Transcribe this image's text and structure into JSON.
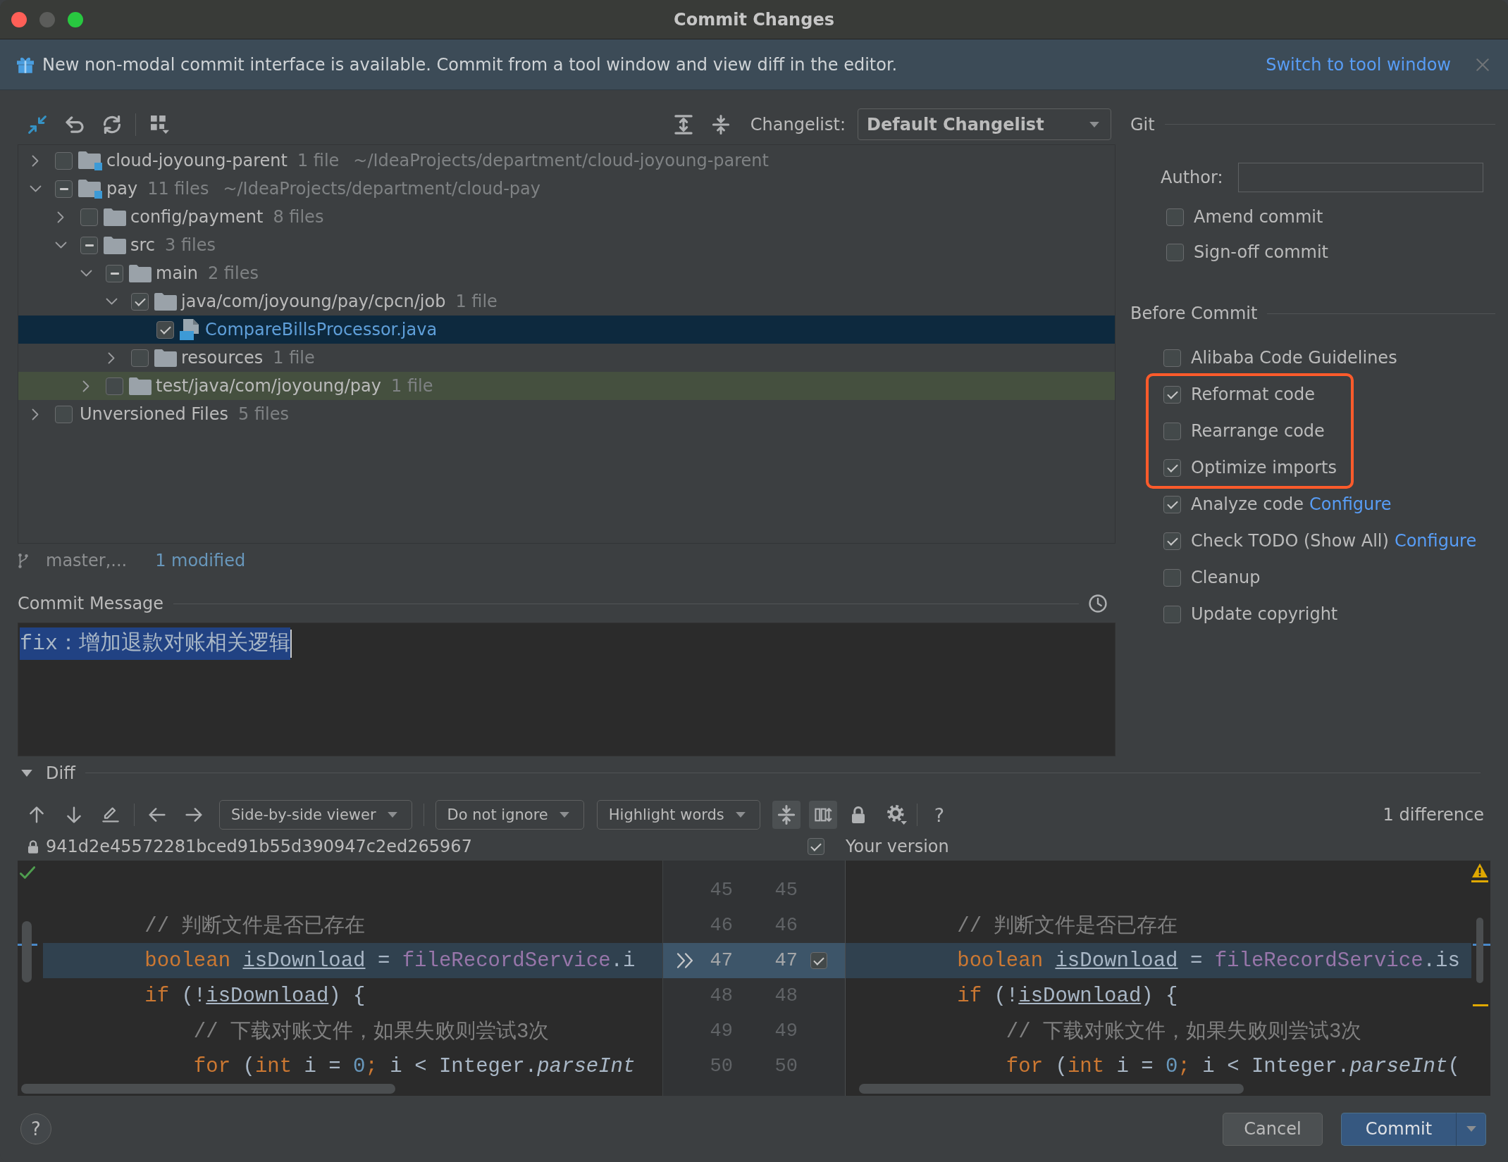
{
  "window": {
    "title": "Commit Changes",
    "controls": [
      {
        "kind": "close",
        "disabled": false
      },
      {
        "kind": "minimize",
        "disabled": true
      },
      {
        "kind": "zoom",
        "disabled": false
      }
    ]
  },
  "banner": {
    "text": "New non-modal commit interface is available. Commit from a tool window and view diff in the editor.",
    "link": "Switch to tool window"
  },
  "changes": {
    "changelist_label": "Changelist:",
    "changelist": "Default Changelist",
    "tree": [
      {
        "name": "cloud-joyoung-parent",
        "kind": "module",
        "count": "1 file",
        "path": "~/IdeaProjects/department/cloud-joyoung-parent",
        "checked": false,
        "partial": false,
        "expanded": false,
        "selected": false,
        "test_source": false
      },
      {
        "name": "pay",
        "kind": "module",
        "count": "11 files",
        "path": "~/IdeaProjects/department/cloud-pay",
        "checked": true,
        "partial": true,
        "expanded": true,
        "selected": false,
        "test_source": false,
        "children": [
          {
            "name": "config/payment",
            "kind": "folder",
            "count": "8 files",
            "checked": false,
            "partial": false,
            "expanded": false,
            "selected": false,
            "test_source": false
          },
          {
            "name": "src",
            "kind": "folder",
            "count": "3 files",
            "checked": true,
            "partial": true,
            "expanded": true,
            "selected": false,
            "test_source": false,
            "children": [
              {
                "name": "main",
                "kind": "folder",
                "count": "2 files",
                "checked": true,
                "partial": true,
                "expanded": true,
                "selected": false,
                "test_source": false,
                "children": [
                  {
                    "name": "java/com/joyoung/pay/cpcn/job",
                    "kind": "folder",
                    "count": "1 file",
                    "checked": true,
                    "partial": false,
                    "expanded": true,
                    "selected": false,
                    "test_source": false,
                    "children": [
                      {
                        "name": "CompareBillsProcessor.java",
                        "kind": "java-file",
                        "modified": true,
                        "checked": true,
                        "partial": false,
                        "selected": true,
                        "test_source": false
                      }
                    ]
                  },
                  {
                    "name": "resources",
                    "kind": "folder",
                    "count": "1 file",
                    "checked": false,
                    "partial": false,
                    "expanded": false,
                    "selected": false,
                    "test_source": false
                  }
                ]
              },
              {
                "name": "test/java/com/joyoung/pay",
                "kind": "folder",
                "count": "1 file",
                "checked": false,
                "partial": false,
                "expanded": false,
                "selected": false,
                "test_source": true
              }
            ]
          }
        ]
      },
      {
        "name": "Unversioned Files",
        "kind": "group",
        "count": "5 files",
        "checked": false,
        "partial": false,
        "expanded": false,
        "selected": false,
        "test_source": false
      }
    ],
    "branch": "master,...",
    "summary": "1 modified"
  },
  "commit_message": {
    "label": "Commit Message",
    "text": "fix：增加退款对账相关逻辑",
    "selected": true
  },
  "git": {
    "title": "Git",
    "author_label": "Author:",
    "options": [
      {
        "label": "Amend commit",
        "checked": false
      },
      {
        "label": "Sign-off commit",
        "checked": false
      }
    ]
  },
  "before_commit": {
    "title": "Before Commit",
    "options": [
      {
        "label": "Alibaba Code Guidelines",
        "checked": false,
        "highlighted": false
      },
      {
        "label": "Reformat code",
        "checked": true,
        "highlighted": true
      },
      {
        "label": "Rearrange code",
        "checked": false,
        "highlighted": true
      },
      {
        "label": "Optimize imports",
        "checked": true,
        "highlighted": true
      },
      {
        "label": "Analyze code",
        "checked": true,
        "highlighted": false,
        "link": "Configure"
      },
      {
        "label": "Check TODO (Show All)",
        "checked": true,
        "highlighted": false,
        "link": "Configure"
      },
      {
        "label": "Cleanup",
        "checked": false,
        "highlighted": false
      },
      {
        "label": "Update copyright",
        "checked": false,
        "highlighted": false
      }
    ]
  },
  "diff": {
    "title": "Diff",
    "expanded": true,
    "toolbar": {
      "dropdowns": [
        {
          "label": "Side-by-side viewer"
        },
        {
          "label": "Do not ignore"
        },
        {
          "label": "Highlight words"
        }
      ],
      "toggles": [
        {
          "kind": "collapse-unchanged",
          "on": true
        },
        {
          "kind": "sync-scroll",
          "on": true
        }
      ],
      "help": "?",
      "count": "1 difference"
    },
    "left": {
      "revision": "941d2e45572281bced91b55d390947c2ed265967"
    },
    "right": {
      "title": "Your version",
      "included": true
    },
    "lines": [
      {
        "left_number": "45",
        "right_number": "45",
        "changed": false
      },
      {
        "left_number": "46",
        "right_number": "46",
        "changed": false,
        "left": [
          {
            "kind": "comment",
            "text": "        // 判断文件是否已存在"
          }
        ],
        "right": [
          {
            "kind": "comment",
            "text": "        // 判断文件是否已存在"
          }
        ]
      },
      {
        "left_number": "47",
        "right_number": "47",
        "changed": true,
        "included": true,
        "left": [
          {
            "kind": "keyword",
            "text": "        boolean "
          },
          {
            "kind": "reassigned",
            "text": "isDownload"
          },
          {
            "kind": "plain",
            "text": " = "
          },
          {
            "kind": "field",
            "text": "fileRecordService"
          },
          {
            "kind": "plain",
            "text": ".i"
          }
        ],
        "right": [
          {
            "kind": "keyword",
            "text": "        boolean "
          },
          {
            "kind": "reassigned",
            "text": "isDownload"
          },
          {
            "kind": "plain",
            "text": " = "
          },
          {
            "kind": "field",
            "text": "fileRecordService"
          },
          {
            "kind": "plain",
            "text": ".is"
          }
        ]
      },
      {
        "left_number": "48",
        "right_number": "48",
        "changed": false,
        "left": [
          {
            "kind": "keyword",
            "text": "        if"
          },
          {
            "kind": "plain",
            "text": " (!"
          },
          {
            "kind": "reassigned",
            "text": "isDownload"
          },
          {
            "kind": "plain",
            "text": ") {"
          }
        ],
        "right": [
          {
            "kind": "keyword",
            "text": "        if"
          },
          {
            "kind": "plain",
            "text": " (!"
          },
          {
            "kind": "reassigned",
            "text": "isDownload"
          },
          {
            "kind": "plain",
            "text": ") {"
          }
        ]
      },
      {
        "left_number": "49",
        "right_number": "49",
        "changed": false,
        "left": [
          {
            "kind": "comment",
            "text": "            // 下载对账文件，如果失败则尝试3次"
          }
        ],
        "right": [
          {
            "kind": "comment",
            "text": "            // 下载对账文件，如果失败则尝试3次"
          }
        ]
      },
      {
        "left_number": "50",
        "right_number": "50",
        "changed": false,
        "left": [
          {
            "kind": "keyword",
            "text": "            for"
          },
          {
            "kind": "plain",
            "text": " ("
          },
          {
            "kind": "keyword",
            "text": "int"
          },
          {
            "kind": "plain",
            "text": " i = "
          },
          {
            "kind": "number",
            "text": "0"
          },
          {
            "kind": "punct",
            "text": ";"
          },
          {
            "kind": "plain",
            "text": " i < Integer."
          },
          {
            "kind": "static",
            "text": "parseInt"
          }
        ],
        "right": [
          {
            "kind": "keyword",
            "text": "            for"
          },
          {
            "kind": "plain",
            "text": " ("
          },
          {
            "kind": "keyword",
            "text": "int"
          },
          {
            "kind": "plain",
            "text": " i = "
          },
          {
            "kind": "number",
            "text": "0"
          },
          {
            "kind": "punct",
            "text": ";"
          },
          {
            "kind": "plain",
            "text": " i < Integer."
          },
          {
            "kind": "static",
            "text": "parseInt"
          },
          {
            "kind": "plain",
            "text": "("
          }
        ]
      }
    ]
  },
  "footer": {
    "help": "?",
    "buttons": [
      {
        "label": "Cancel",
        "kind": "plain"
      },
      {
        "label": "Commit",
        "kind": "primary-split"
      }
    ]
  }
}
